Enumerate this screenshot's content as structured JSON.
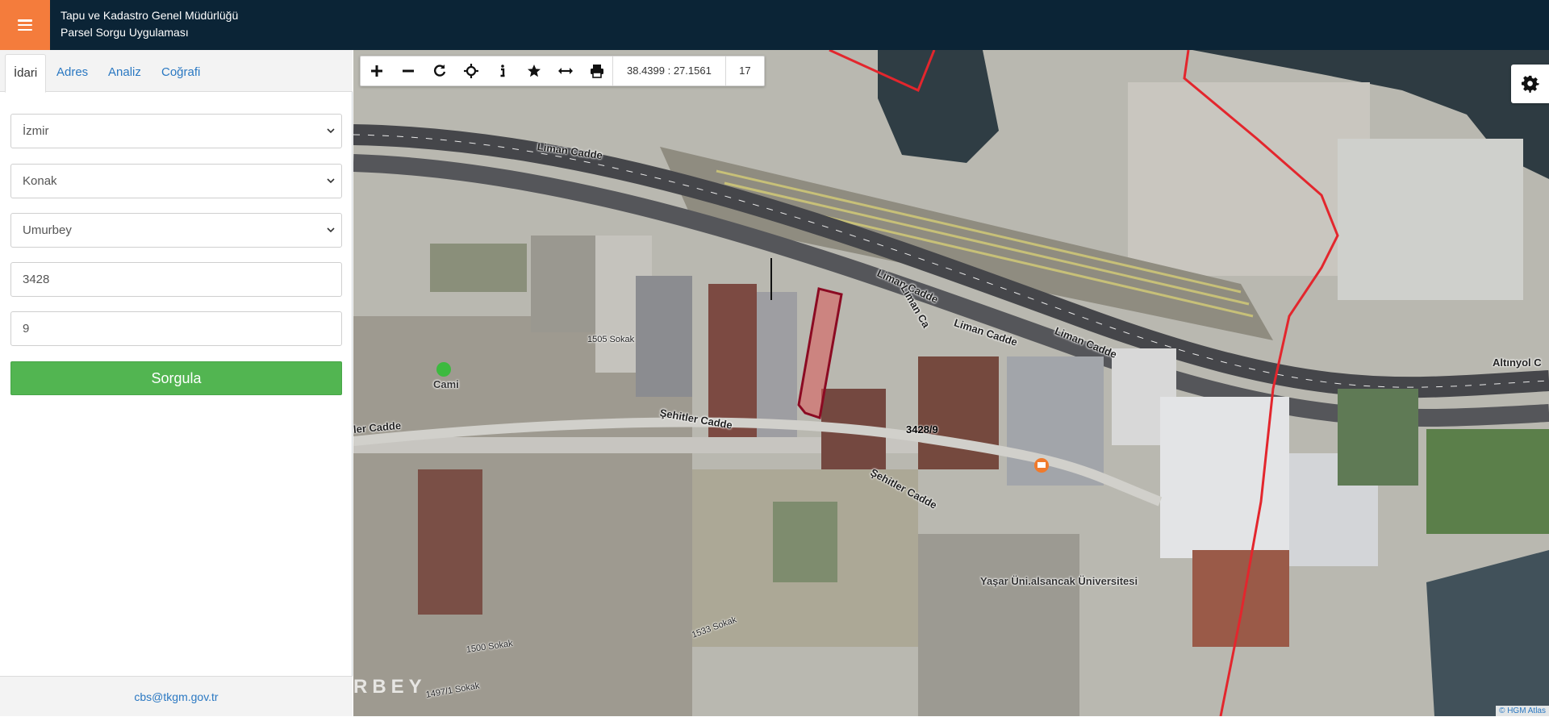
{
  "header": {
    "title_line1": "Tapu ve Kadastro Genel Müdürlüğü",
    "title_line2": "Parsel Sorgu Uygulaması"
  },
  "sidebar": {
    "tabs": [
      {
        "label": "İdari",
        "active": true
      },
      {
        "label": "Adres",
        "active": false
      },
      {
        "label": "Analiz",
        "active": false
      },
      {
        "label": "Coğrafi",
        "active": false
      }
    ],
    "form": {
      "il": "İzmir",
      "ilce": "Konak",
      "mahalle": "Umurbey",
      "ada": "3428",
      "parsel": "9",
      "submit_label": "Sorgula"
    },
    "footer_email": "cbs@tkgm.gov.tr"
  },
  "map": {
    "toolbar": {
      "tools": [
        "plus-icon",
        "minus-icon",
        "refresh-icon",
        "crosshair-icon",
        "info-icon",
        "star-icon",
        "measure-icon",
        "print-icon"
      ],
      "coordinates": "38.4399 : 27.1561",
      "zoom_level": "17"
    },
    "parcel_label": "3428/9",
    "street_labels": {
      "liman_1": "Liman Cadde",
      "liman_2": "Liman Cadde",
      "liman_3": "Liman Ca",
      "liman_4": "Liman Cadde",
      "liman_5": "Liman Cadde",
      "altinyol": "Altınyol C",
      "sehitler_1": "Şehitler Cadde",
      "sehitler_2": "Şehitler Cadde",
      "ler_cadde": "ler Cadde",
      "s1505": "1505 Sokak",
      "s1500": "1500 Sokak",
      "s1497": "1497/1 Sokak",
      "s1533": "1533 Sokak"
    },
    "poi": {
      "cami": "Cami",
      "university": "Yaşar Üni.alsancak Üniversitesi"
    },
    "watermark": "RBEY",
    "attribution": "© HGM Atlas",
    "colors": {
      "parcel_outline": "#8b0a22",
      "boundary_line": "#e3262d",
      "sea": "#2f3d44"
    }
  }
}
